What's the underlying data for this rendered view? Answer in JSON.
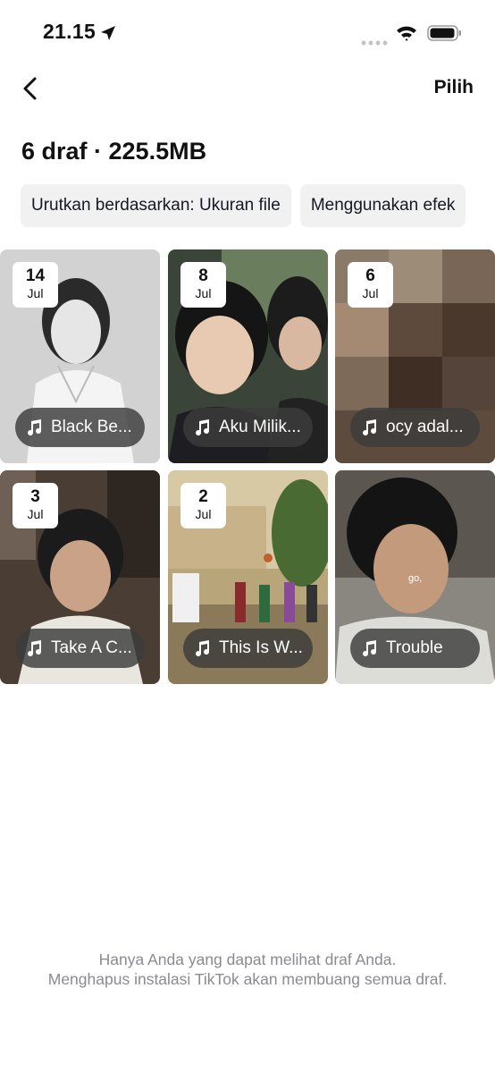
{
  "status_bar": {
    "time": "21.15"
  },
  "nav": {
    "action_label": "Pilih"
  },
  "page_title": "6 draf · 225.5MB",
  "filters": [
    {
      "label": "Urutkan berdasarkan: Ukuran file"
    },
    {
      "label": "Menggunakan efek"
    }
  ],
  "drafts": [
    {
      "day": "14",
      "month": "Jul",
      "music": "Black Be..."
    },
    {
      "day": "8",
      "month": "Jul",
      "music": "Aku Milik..."
    },
    {
      "day": "6",
      "month": "Jul",
      "music": "ocy adal..."
    },
    {
      "day": "3",
      "month": "Jul",
      "music": "Take A C..."
    },
    {
      "day": "2",
      "month": "Jul",
      "music": "This Is W..."
    },
    {
      "music": "Trouble",
      "subtitle": "go,"
    }
  ],
  "footer": {
    "line1": "Hanya Anda yang dapat melihat draf Anda.",
    "line2": "Menghapus instalasi TikTok akan membuang semua draf."
  }
}
